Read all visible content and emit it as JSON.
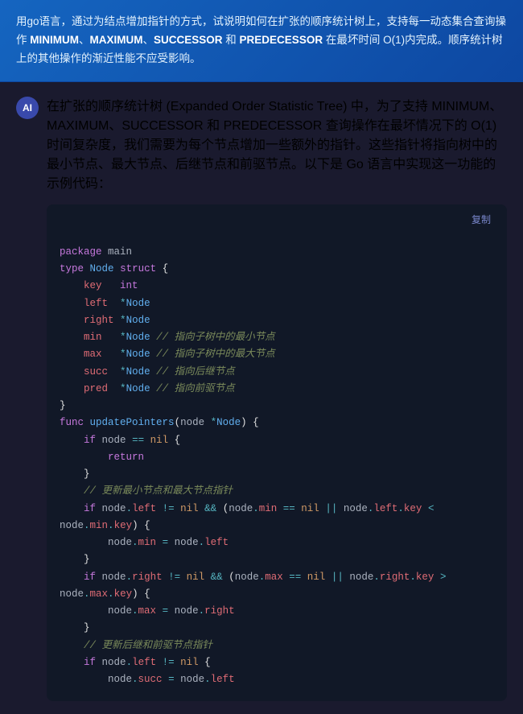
{
  "page": {
    "bg_color": "#1a1a2e"
  },
  "info_box": {
    "text": "用go语言，通过为结点增加指针的方式，试说明如何在扩张的顺序统计树上，支持每一动态集合查询操作 MINIMUM、MAXIMUM、SUCCESSOR 和 PREDECESSOR 在最坏时间 O(1)内完成。顺序统计树上的其他操作的渐近性能不应受影响。",
    "keywords": [
      "MINIMUM",
      "MAXIMUM",
      "SUCCESSOR",
      "PREDECESSOR",
      "O(1)"
    ]
  },
  "main_text": {
    "para": "在扩张的顺序统计树 (Expanded Order Statistic Tree) 中，为了支持 MINIMUM、MAXIMUM、SUCCESSOR 和 PREDECESSOR 查询操作在最坏情况下的 O(1) 时间复杂度，我们需要为每个节点增加一些额外的指针。这些指针将指向树中的最小节点、最大节点、后继节点和前驱节点。以下是 Go 语言中实现这一功能的示例代码："
  },
  "copy_button": {
    "label": "复制"
  },
  "code": {
    "lines": [
      {
        "indent": 0,
        "content": "package main"
      },
      {
        "indent": 0,
        "content": ""
      },
      {
        "indent": 0,
        "content": "type Node struct {"
      },
      {
        "indent": 1,
        "content": "key   int"
      },
      {
        "indent": 1,
        "content": "left  *Node"
      },
      {
        "indent": 1,
        "content": "right *Node"
      },
      {
        "indent": 1,
        "content": "min   *Node // 指向子树中的最小节点"
      },
      {
        "indent": 1,
        "content": "max   *Node // 指向子树中的最大节点"
      },
      {
        "indent": 1,
        "content": "succ  *Node // 指向后继节点"
      },
      {
        "indent": 1,
        "content": "pred  *Node // 指向前驱节点"
      },
      {
        "indent": 0,
        "content": "}"
      },
      {
        "indent": 0,
        "content": ""
      },
      {
        "indent": 0,
        "content": "func updatePointers(node *Node) {"
      },
      {
        "indent": 1,
        "content": "if node == nil {"
      },
      {
        "indent": 2,
        "content": "return"
      },
      {
        "indent": 1,
        "content": "}"
      },
      {
        "indent": 0,
        "content": ""
      },
      {
        "indent": 1,
        "content": "// 更新最小节点和最大节点指针"
      },
      {
        "indent": 1,
        "content": "if node.left != nil && (node.min == nil || node.left.key < node.min.key) {"
      },
      {
        "indent": 2,
        "content": "node.min = node.left"
      },
      {
        "indent": 1,
        "content": "}"
      },
      {
        "indent": 1,
        "content": "if node.right != nil && (node.max == nil || node.right.key > node.max.key) {"
      },
      {
        "indent": 2,
        "content": "node.max = node.right"
      },
      {
        "indent": 1,
        "content": "}"
      },
      {
        "indent": 0,
        "content": ""
      },
      {
        "indent": 1,
        "content": "// 更新后继和前驱节点指针"
      },
      {
        "indent": 1,
        "content": "if node.left != nil {"
      },
      {
        "indent": 2,
        "content": "node.succ = node.left"
      }
    ]
  }
}
